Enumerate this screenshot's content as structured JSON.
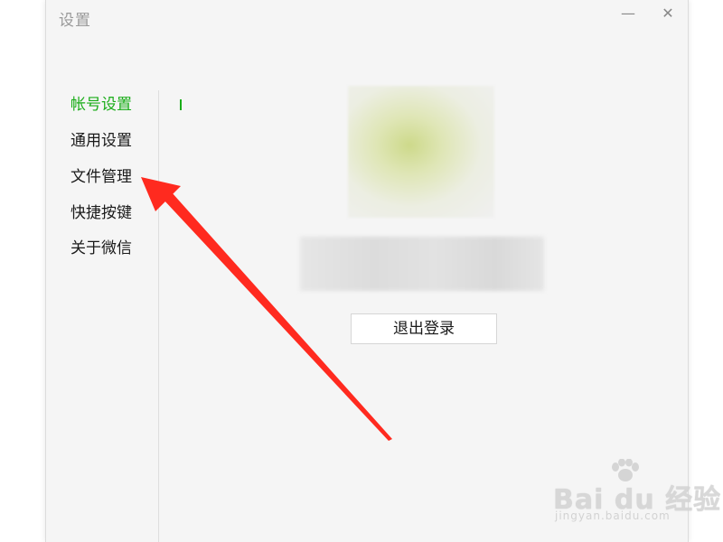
{
  "window": {
    "title": "设置",
    "minimize_glyph": "—",
    "close_glyph": "✕"
  },
  "sidebar": {
    "items": [
      {
        "label": "帐号设置",
        "active": true
      },
      {
        "label": "通用设置",
        "active": false
      },
      {
        "label": "文件管理",
        "active": false
      },
      {
        "label": "快捷按键",
        "active": false
      },
      {
        "label": "关于微信",
        "active": false
      }
    ]
  },
  "account": {
    "logout_label": "退出登录"
  },
  "annotation": {
    "arrow_color": "#ff2a1f"
  },
  "watermark": {
    "main": "Bai du 经验",
    "sub": "jingyan.baidu.com"
  },
  "colors": {
    "accent": "#1aad19",
    "window_bg": "#f5f5f5"
  }
}
